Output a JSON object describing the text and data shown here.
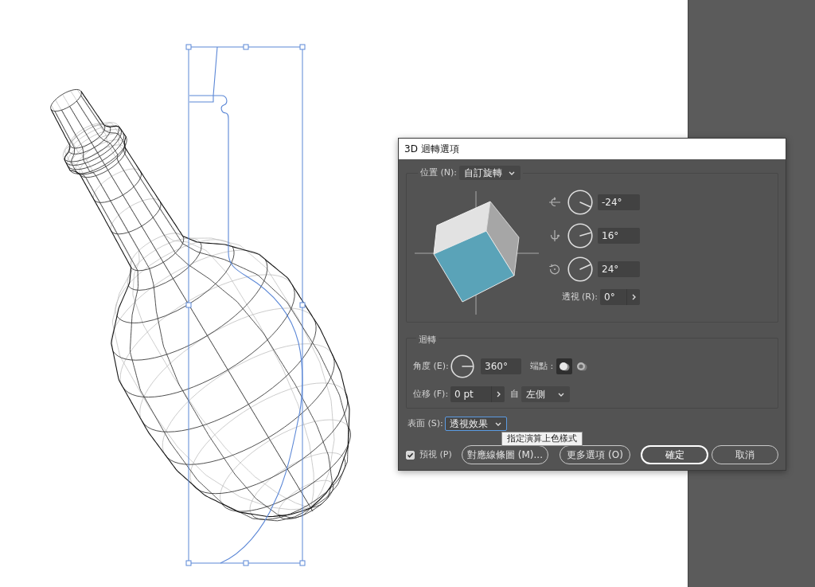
{
  "dialog": {
    "title": "3D 迴轉選項"
  },
  "position": {
    "label": "位置 (N):",
    "preset": "自訂旋轉",
    "rotations": [
      {
        "kind": "x",
        "value": "-24°"
      },
      {
        "kind": "y",
        "value": "16°"
      },
      {
        "kind": "z",
        "value": "24°"
      }
    ],
    "perspective": {
      "label": "透視 (R):",
      "value": "0°"
    }
  },
  "revolve": {
    "title": "迴轉",
    "angle": {
      "label": "角度 (E):",
      "value": "360°"
    },
    "cap": {
      "label": "端點 :",
      "options": [
        {
          "kind": "on",
          "selected": true
        },
        {
          "kind": "off",
          "selected": false
        }
      ]
    },
    "offset": {
      "label": "位移 (F):",
      "value": "0 pt",
      "from_label": "自",
      "from": "左側"
    }
  },
  "surface": {
    "label": "表面 (S):",
    "value": "透視效果",
    "focused": true
  },
  "tooltip": {
    "text": "指定演算上色樣式"
  },
  "preview": {
    "label": "預視 (P)",
    "checked": true
  },
  "buttons": [
    {
      "label": "對應線條圖 (M)...",
      "default": false
    },
    {
      "label": "更多選項 (O)",
      "default": false
    },
    {
      "label": "確定",
      "default": true
    },
    {
      "label": "取消",
      "default": false
    }
  ]
}
